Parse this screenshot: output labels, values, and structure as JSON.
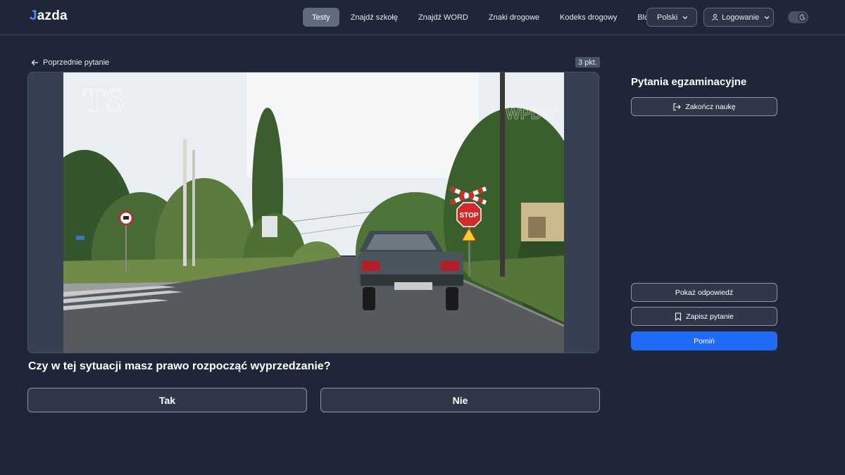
{
  "header": {
    "logo_initial": "J",
    "logo_rest": "azda",
    "nav": [
      {
        "label": "Testy",
        "active": true
      },
      {
        "label": "Znajdź szkołę",
        "active": false
      },
      {
        "label": "Znajdź WORD",
        "active": false
      },
      {
        "label": "Znaki drogowe",
        "active": false
      },
      {
        "label": "Kodeks drogowy",
        "active": false
      },
      {
        "label": "Blog",
        "active": false
      }
    ],
    "language": "Polski",
    "login": "Logowanie"
  },
  "question": {
    "back_label": "Poprzednie pytanie",
    "points": "3 pkt.",
    "text": "Czy w tej sytuacji masz prawo rozpocząć wyprzedzanie?",
    "answers": [
      "Tak",
      "Nie"
    ],
    "image_watermarks": [
      "TS",
      "WPDW"
    ],
    "sign_text": "STOP"
  },
  "sidebar": {
    "title": "Pytania egzaminacyjne",
    "finish_label": "Zakończ naukę",
    "show_answer_label": "Pokaż odpowiedź",
    "save_label": "Zapisz pytanie",
    "skip_label": "Pomiń"
  },
  "colors": {
    "background": "#1f2637",
    "accent": "#1f6bf5",
    "active_nav": "#606b7e"
  },
  "icons": [
    "arrow-left-icon",
    "chevron-down-icon",
    "user-icon",
    "moon-icon",
    "logout-icon",
    "bookmark-icon"
  ]
}
